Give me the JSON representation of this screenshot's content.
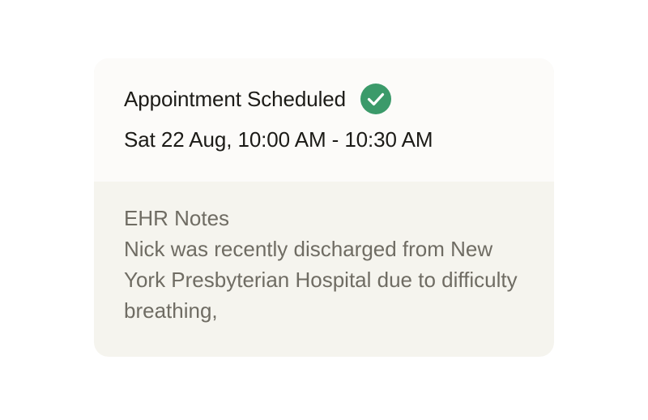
{
  "appointment": {
    "title": "Appointment Scheduled",
    "status_icon": "check-circle-icon",
    "status_color": "#3b9a6a",
    "datetime": "Sat 22 Aug, 10:00 AM - 10:30 AM"
  },
  "ehr_notes": {
    "title": "EHR Notes",
    "body": "Nick was recently discharged from New York Presbyterian Hospital due to difficulty breathing,"
  }
}
